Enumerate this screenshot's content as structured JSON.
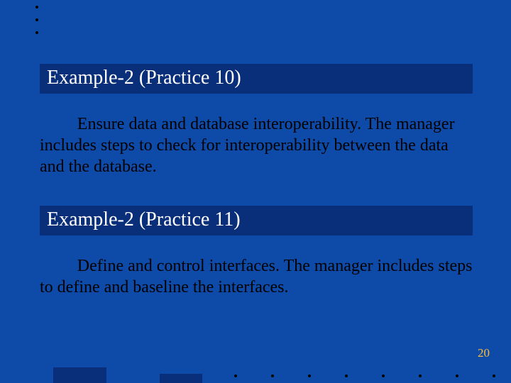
{
  "heading1": "Example-2 (Practice 10)",
  "body1": "Ensure data and database interoperability. The manager includes steps to check for interoperability between the data and the database.",
  "heading2": "Example-2 (Practice 11)",
  "body2": "Define and control interfaces. The manager includes steps to define and baseline the interfaces.",
  "page_number": "20"
}
